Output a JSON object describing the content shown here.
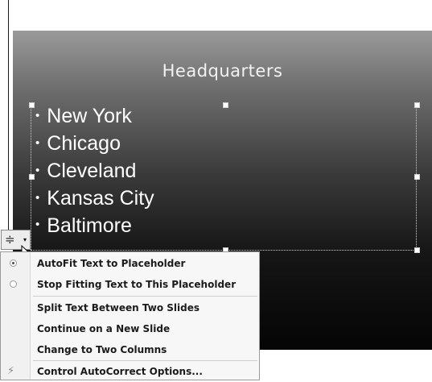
{
  "slide": {
    "title": "Headquarters",
    "bullets": [
      "New York",
      "Chicago",
      "Cleveland",
      "Kansas City",
      "Baltimore"
    ]
  },
  "autofit_button": {
    "icon": "autofit-options-icon",
    "glyph": "≑",
    "dropdown_arrow": "▾"
  },
  "menu": {
    "items": [
      {
        "label": "AutoFit Text to Placeholder",
        "state": "selected"
      },
      {
        "label": "Stop Fitting Text to This Placeholder",
        "state": "unselected"
      },
      {
        "label": "Split Text Between Two Slides"
      },
      {
        "label": "Continue on a New Slide"
      },
      {
        "label": "Change to Two Columns"
      },
      {
        "label": "Control AutoCorrect Options...",
        "icon": "autocorrect-lightning-icon"
      }
    ]
  },
  "colors": {
    "slide_top": "#9a9a9a",
    "slide_bottom": "#050505",
    "menu_bg": "#f7f7f7",
    "text_white": "#ffffff"
  }
}
